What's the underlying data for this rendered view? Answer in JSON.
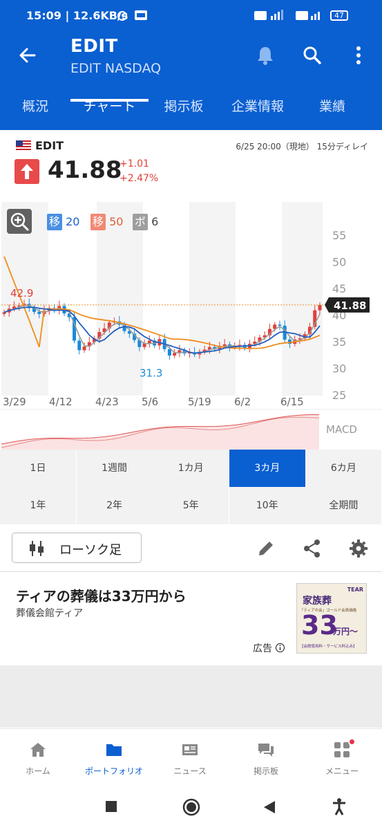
{
  "status_bar": {
    "time": "15:09",
    "speed": "12.6KB/s",
    "battery": "47"
  },
  "header": {
    "title": "EDIT",
    "subtitle": "EDIT NASDAQ",
    "tabs": [
      {
        "label": "概況",
        "active": false
      },
      {
        "label": "チャート",
        "active": true
      },
      {
        "label": "掲示板",
        "active": false
      },
      {
        "label": "企業情報",
        "active": false
      },
      {
        "label": "業績",
        "active": false
      }
    ]
  },
  "quote": {
    "ticker": "EDIT",
    "time": "6/25 20:00（現地） 15分ディレイ",
    "price": "41.88",
    "change": "+1.01",
    "change_pct": "+2.47%"
  },
  "chart_legend": [
    {
      "tag": "移",
      "value": "20",
      "tag_color": "#4a90e2",
      "text_color": "#1a62c8"
    },
    {
      "tag": "移",
      "value": "50",
      "tag_color": "#f08a74",
      "text_color": "#e0603a"
    },
    {
      "tag": "ボ",
      "value": "6",
      "tag_color": "#9e9e9e",
      "text_color": "#444444"
    }
  ],
  "chart_data": {
    "type": "candlestick",
    "y_ticks": [
      "55",
      "50",
      "45",
      "40",
      "35",
      "30",
      "25"
    ],
    "x_ticks": [
      "3/29",
      "4/12",
      "4/23",
      "5/6",
      "5/19",
      "6/2",
      "6/15"
    ],
    "ylim": [
      25,
      55
    ],
    "last_price_label": "41.88",
    "annotations": [
      {
        "text": "42.9",
        "value": 42.9,
        "color": "#e0403a"
      },
      {
        "text": "31.3",
        "value": 31.3,
        "color": "#1a8ad8"
      }
    ],
    "sub_chart_label": "MACD",
    "series": [
      {
        "name": "移 20",
        "color": "#1f5fbf"
      },
      {
        "name": "移 50",
        "color": "#f08c1a"
      },
      {
        "name": "ボ 6",
        "color": "#999999"
      }
    ],
    "close": [
      40.5,
      41.2,
      41.6,
      41.8,
      42.1,
      41.4,
      40.6,
      40.2,
      40.8,
      41.3,
      40.9,
      41.7,
      40.3,
      39.6,
      35.2,
      33.4,
      34.1,
      34.9,
      35.6,
      36.8,
      37.5,
      38.6,
      38.8,
      38.2,
      37.0,
      36.5,
      35.3,
      34.0,
      34.7,
      35.2,
      34.3,
      35.5,
      33.6,
      32.4,
      32.9,
      33.4,
      32.8,
      33.0,
      32.6,
      33.1,
      33.5,
      34.0,
      33.6,
      34.2,
      34.5,
      34.0,
      34.1,
      34.4,
      33.8,
      34.6,
      35.0,
      35.8,
      36.2,
      37.4,
      38.2,
      38.0,
      35.4,
      34.6,
      35.4,
      35.6,
      36.4,
      37.8,
      40.9,
      41.9
    ]
  },
  "periods": [
    "1日",
    "1週間",
    "1カ月",
    "3カ月",
    "6カ月",
    "1年",
    "2年",
    "5年",
    "10年",
    "全期間"
  ],
  "active_period": "3カ月",
  "chart_type_button": "ローソク足",
  "ad": {
    "title": "ティアの葬儀は33万円から",
    "sponsor": "葬儀会館ティア",
    "label": "広告",
    "image_brand": "TEAR",
    "image_heading": "家族葬",
    "image_sub": "「ティアの会」ゴールド会員価格",
    "image_price": "33",
    "image_unit": "万円〜",
    "image_note": "【会館使用料・サービス料込み】"
  },
  "bottom_nav": [
    {
      "label": "ホーム",
      "icon": "home-icon",
      "active": false
    },
    {
      "label": "ポートフォリオ",
      "icon": "folder-icon",
      "active": true
    },
    {
      "label": "ニュース",
      "icon": "news-icon",
      "active": false
    },
    {
      "label": "掲示板",
      "icon": "chat-icon",
      "active": false
    },
    {
      "label": "メニュー",
      "icon": "grid-menu-icon",
      "active": false
    }
  ],
  "colors": {
    "primary": "#0a5fd1",
    "up": "#e0403a",
    "down": "#1a8ad8"
  }
}
